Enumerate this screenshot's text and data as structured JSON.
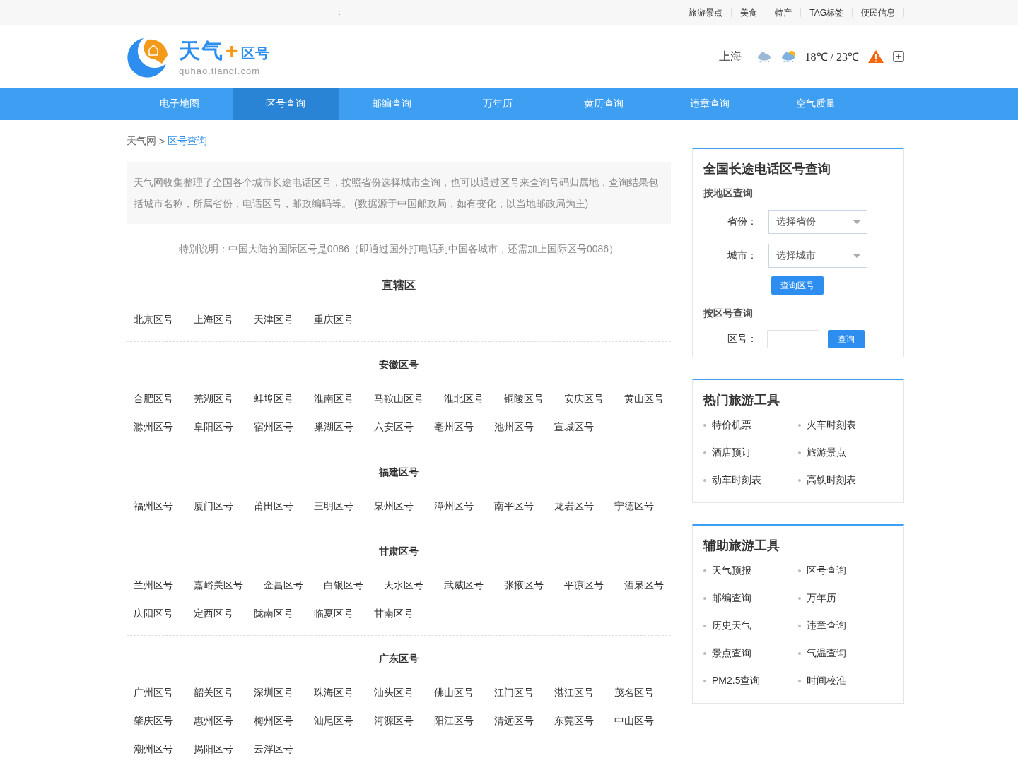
{
  "top_bar": {
    "marker": ":",
    "links": [
      "旅游景点",
      "美食",
      "特产",
      "TAG标签",
      "便民信息"
    ]
  },
  "header": {
    "logo": {
      "title": "天气",
      "plus": "+",
      "suffix": "区号",
      "domain": "quhao.tianqi.com"
    },
    "weather": {
      "city": "上海",
      "temperature": "18℃ / 23℃"
    }
  },
  "nav": [
    {
      "label": "电子地图",
      "selected": false
    },
    {
      "label": "区号查询",
      "selected": true
    },
    {
      "label": "邮编查询",
      "selected": false
    },
    {
      "label": "万年历",
      "selected": false
    },
    {
      "label": "黄历查询",
      "selected": false
    },
    {
      "label": "违章查询",
      "selected": false
    },
    {
      "label": "空气质量",
      "selected": false
    }
  ],
  "breadcrumb": {
    "home": "天气网",
    "separator": ">",
    "current": "区号查询"
  },
  "intro": "天气网收集整理了全国各个城市长途电话区号，按照省份选择城市查询，也可以通过区号来查询号码归属地，查询结果包括城市名称，所属省份，电话区号，邮政编码等。 (数据源于中国邮政局，如有变化，以当地邮政局为主)",
  "note": "特别说明：中国大陆的国际区号是0086（即通过国外打电话到中国各城市，还需加上国际区号0086）",
  "sections": [
    {
      "title": "直辖区",
      "cities": [
        "北京区号",
        "上海区号",
        "天津区号",
        "重庆区号"
      ]
    },
    {
      "title": "安徽区号",
      "cities": [
        "合肥区号",
        "芜湖区号",
        "蚌埠区号",
        "淮南区号",
        "马鞍山区号",
        "淮北区号",
        "铜陵区号",
        "安庆区号",
        "黄山区号",
        "滁州区号",
        "阜阳区号",
        "宿州区号",
        "巢湖区号",
        "六安区号",
        "亳州区号",
        "池州区号",
        "宣城区号"
      ]
    },
    {
      "title": "福建区号",
      "cities": [
        "福州区号",
        "厦门区号",
        "莆田区号",
        "三明区号",
        "泉州区号",
        "漳州区号",
        "南平区号",
        "龙岩区号",
        "宁德区号"
      ]
    },
    {
      "title": "甘肃区号",
      "cities": [
        "兰州区号",
        "嘉峪关区号",
        "金昌区号",
        "白银区号",
        "天水区号",
        "武威区号",
        "张掖区号",
        "平凉区号",
        "酒泉区号",
        "庆阳区号",
        "定西区号",
        "陇南区号",
        "临夏区号",
        "甘南区号"
      ]
    },
    {
      "title": "广东区号",
      "cities": [
        "广州区号",
        "韶关区号",
        "深圳区号",
        "珠海区号",
        "汕头区号",
        "佛山区号",
        "江门区号",
        "湛江区号",
        "茂名区号",
        "肇庆区号",
        "惠州区号",
        "梅州区号",
        "汕尾区号",
        "河源区号",
        "阳江区号",
        "清远区号",
        "东莞区号",
        "中山区号",
        "潮州区号",
        "揭阳区号",
        "云浮区号"
      ]
    }
  ],
  "query_box": {
    "title": "全国长途电话区号查询",
    "by_region": "按地区查询",
    "province_label": "省份：",
    "province_placeholder": "选择省份",
    "city_label": "城市：",
    "city_placeholder": "选择城市",
    "region_button": "查询区号",
    "by_code": "按区号查询",
    "code_label": "区号：",
    "code_button": "查询"
  },
  "tool_boxes": [
    {
      "title": "热门旅游工具",
      "items": [
        "特价机票",
        "火车时刻表",
        "酒店预订",
        "旅游景点",
        "动车时刻表",
        "高铁时刻表"
      ]
    },
    {
      "title": "辅助旅游工具",
      "items": [
        "天气预报",
        "区号查询",
        "邮编查询",
        "万年历",
        "历史天气",
        "违章查询",
        "景点查询",
        "气温查询",
        "PM2.5查询",
        "时间校准"
      ]
    }
  ]
}
